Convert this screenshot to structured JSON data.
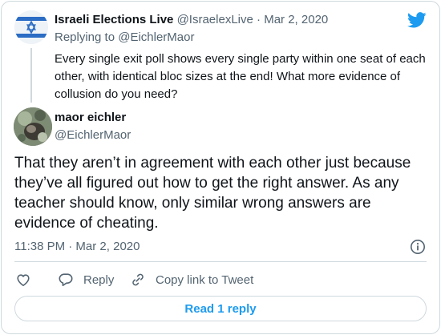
{
  "parent_tweet": {
    "display_name": "Israeli Elections Live",
    "handle": "@IsraelexLive",
    "separator": "·",
    "date": "Mar 2, 2020",
    "replying_prefix": "Replying to",
    "replying_to": "@EichlerMaor",
    "text": "Every single exit poll shows every single party within one seat of each other, with identical bloc sizes at the end! What more evidence of collusion do you need?"
  },
  "main_tweet": {
    "display_name": "maor eichler",
    "handle": "@EichlerMaor",
    "text": "That they aren’t in agreement with each other just because they’ve all figured out how to get the right answer. As any teacher should know, only similar wrong answers are evidence of cheating.",
    "time": "11:38 PM · Mar 2, 2020"
  },
  "actions": {
    "reply_label": "Reply",
    "copy_label": "Copy link to Tweet"
  },
  "read_reply_label": "Read 1 reply",
  "colors": {
    "twitter_blue": "#1d9bf0",
    "text_primary": "#0f1419",
    "text_secondary": "#536471",
    "border": "#cfd9de"
  },
  "icons": [
    "twitter-logo-icon",
    "info-icon",
    "heart-icon",
    "reply-icon",
    "link-icon"
  ]
}
